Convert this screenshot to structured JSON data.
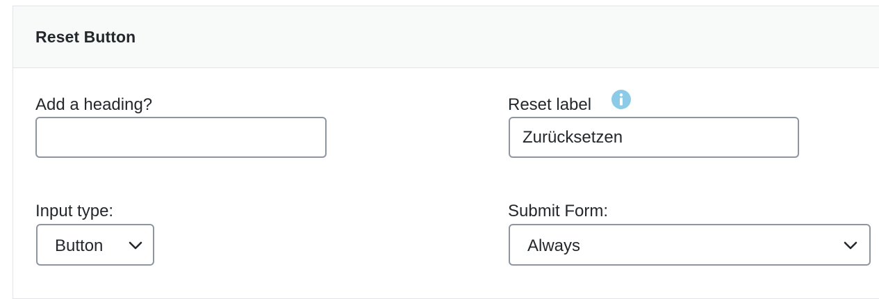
{
  "panel": {
    "title": "Reset Button"
  },
  "fields": {
    "heading": {
      "label": "Add a heading?",
      "value": "",
      "placeholder": ""
    },
    "reset_label": {
      "label": "Reset label",
      "value": "Zurücksetzen",
      "info_icon": "info-icon"
    },
    "input_type": {
      "label": "Input type:",
      "selected": "Button"
    },
    "submit_form": {
      "label": "Submit Form:",
      "selected": "Always"
    }
  },
  "colors": {
    "header_bg": "#f8f9f9",
    "border": "#8d96a0",
    "info_icon": "#8ccbe8",
    "text": "#23282d"
  }
}
